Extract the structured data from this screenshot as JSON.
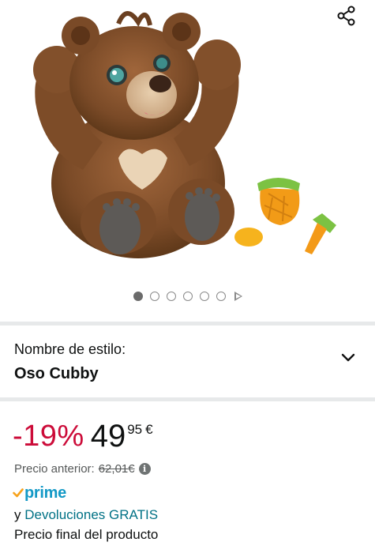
{
  "gallery": {
    "image_alt": "Oso Cubby",
    "dots_total": 6,
    "active_dot": 1,
    "share_icon": "share-icon"
  },
  "style_selector": {
    "label": "Nombre de estilo:",
    "value": "Oso Cubby",
    "icon": "chevron-down-icon"
  },
  "pricing": {
    "discount": "-19%",
    "price_whole": "49",
    "price_fraction": "95",
    "currency": "€",
    "previous_label": "Precio anterior:",
    "previous_value": "62,01€",
    "info_icon": "info-icon"
  },
  "delivery": {
    "prime_label": "prime",
    "returns_prefix": "y",
    "returns_link": "Devoluciones GRATIS",
    "final_price_note": "Precio final del producto"
  },
  "colors": {
    "discount_red": "#cc0c39",
    "link_teal": "#007185",
    "prime_blue": "#1399c6",
    "prime_check": "#f7a21b",
    "divider": "#e7e9ea"
  }
}
